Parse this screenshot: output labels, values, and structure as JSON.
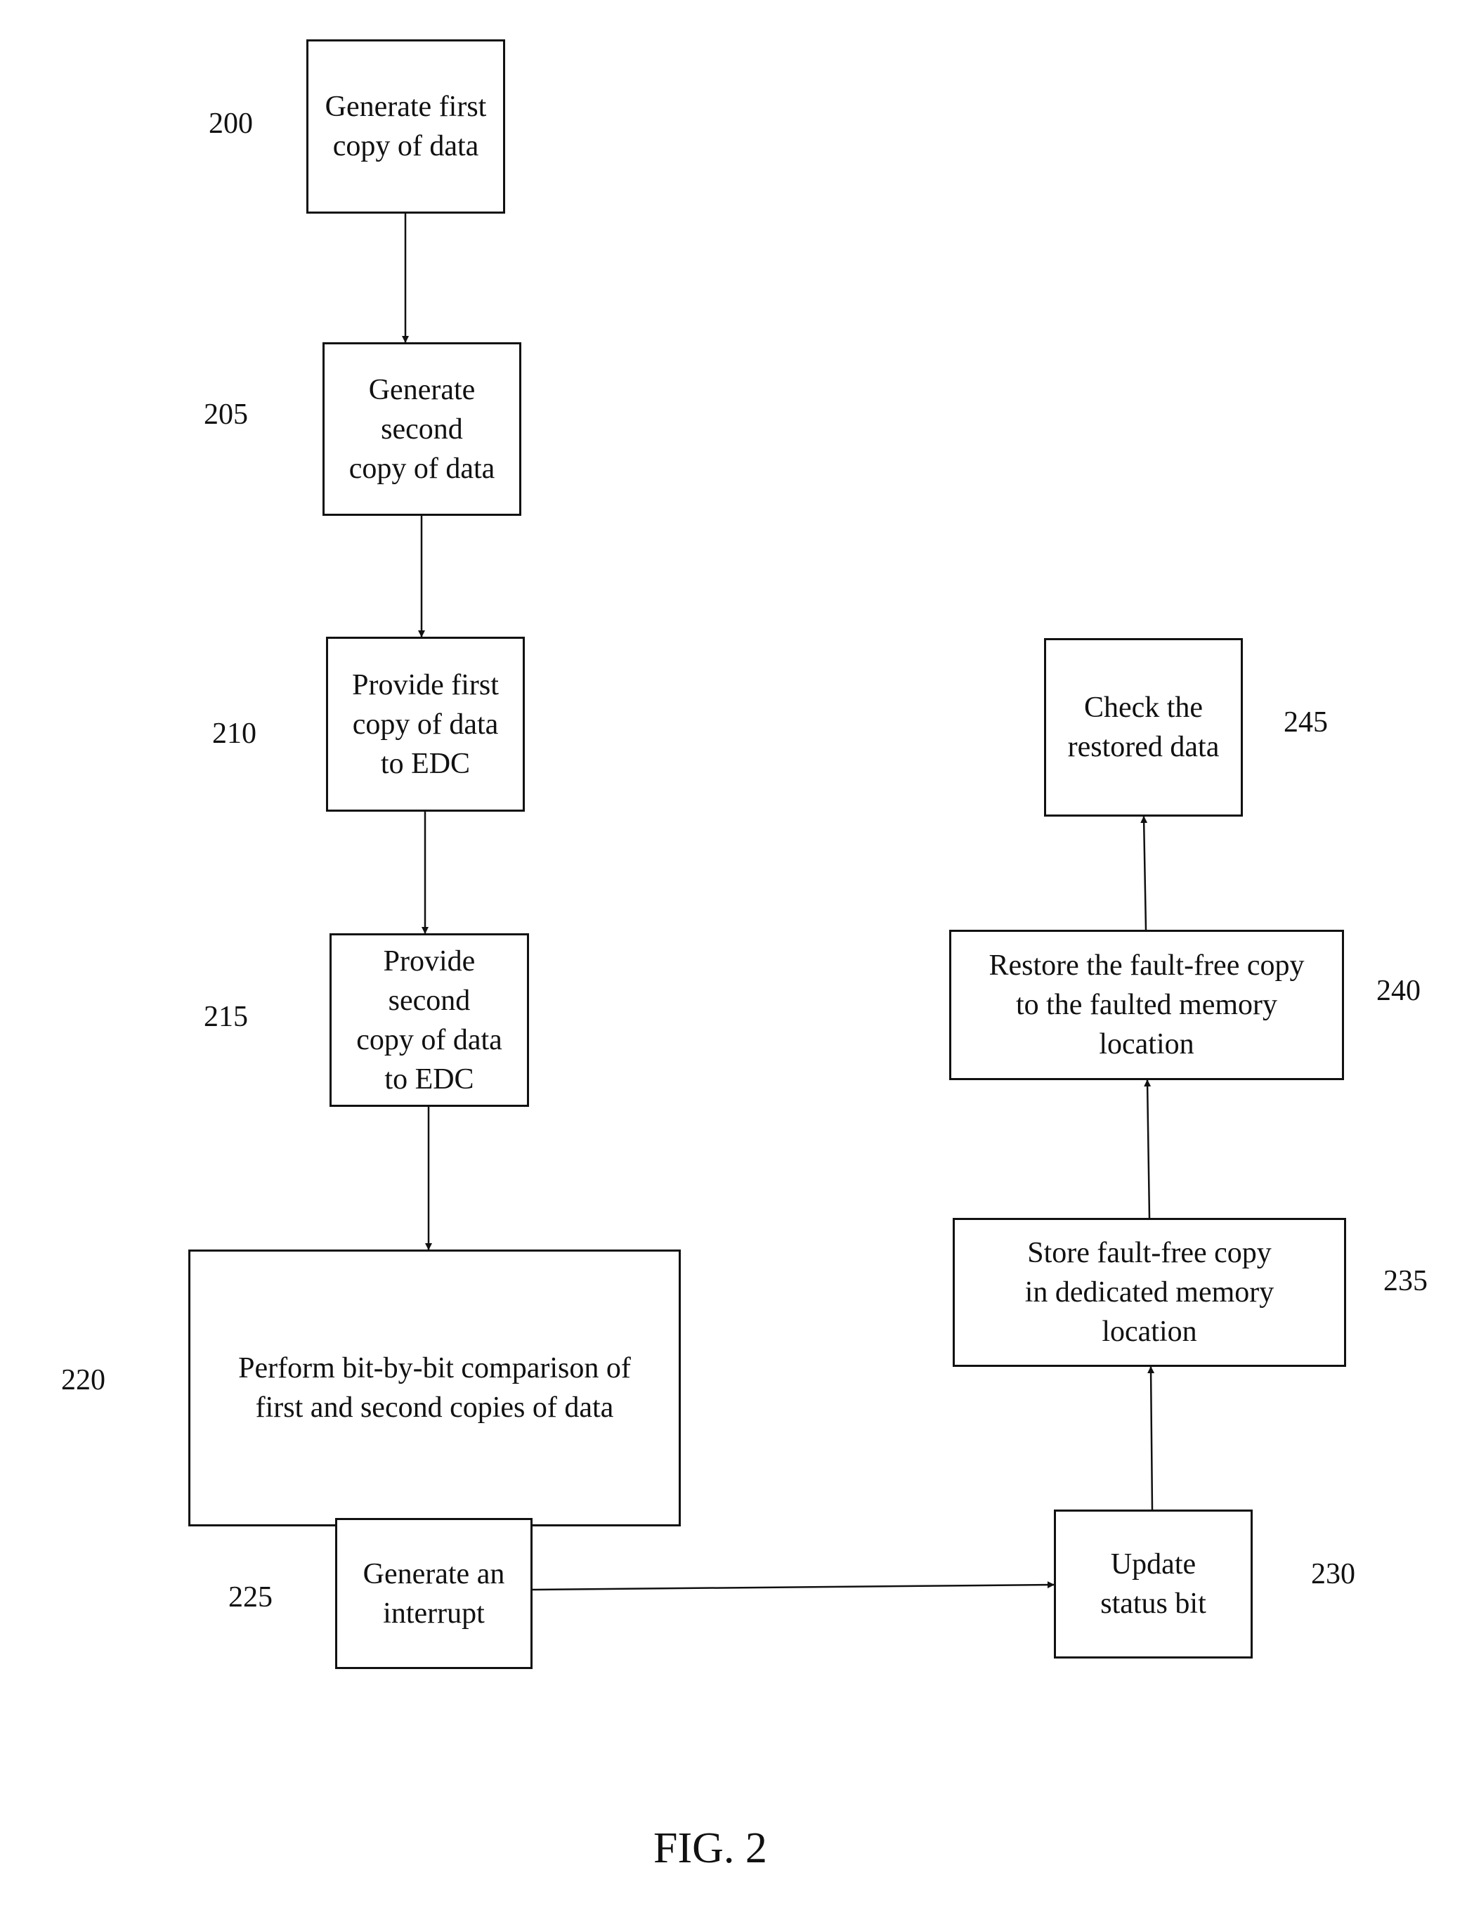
{
  "figure_label": "FIG. 2",
  "steps": [
    {
      "ref": "200",
      "text": "Generate first\ncopy of data"
    },
    {
      "ref": "205",
      "text": "Generate\nsecond\ncopy of data"
    },
    {
      "ref": "210",
      "text": "Provide first\ncopy of data\nto EDC"
    },
    {
      "ref": "215",
      "text": "Provide\nsecond\ncopy of data\nto EDC"
    },
    {
      "ref": "220",
      "text": "Perform bit-by-bit comparison of\nfirst and second copies of data"
    },
    {
      "ref": "225",
      "text": "Generate an\ninterrupt"
    },
    {
      "ref": "230",
      "text": "Update\nstatus bit"
    },
    {
      "ref": "235",
      "text": "Store fault-free copy\nin dedicated memory\nlocation"
    },
    {
      "ref": "240",
      "text": "Restore the fault-free copy\nto the faulted memory\nlocation"
    },
    {
      "ref": "245",
      "text": "Check the\nrestored data"
    }
  ],
  "connections": [
    {
      "from": "200",
      "to": "205"
    },
    {
      "from": "205",
      "to": "210"
    },
    {
      "from": "210",
      "to": "215"
    },
    {
      "from": "215",
      "to": "220"
    },
    {
      "from": "220",
      "to": "225"
    },
    {
      "from": "225",
      "to": "230"
    },
    {
      "from": "230",
      "to": "235"
    },
    {
      "from": "235",
      "to": "240"
    },
    {
      "from": "240",
      "to": "245"
    }
  ]
}
